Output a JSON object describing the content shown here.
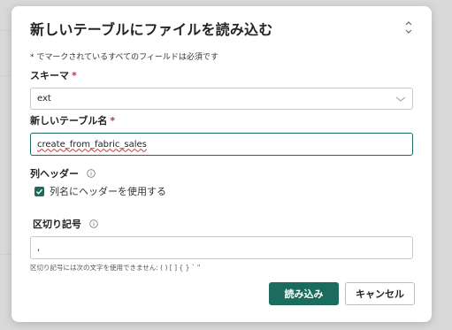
{
  "dialog": {
    "title": "新しいテーブルにファイルを読み込む",
    "required_note": "* でマークされているすべてのフィールドは必須です",
    "schema": {
      "label": "スキーマ",
      "required_mark": "*",
      "value": "ext",
      "icon": "chevron-down-icon"
    },
    "table_name": {
      "label": "新しいテーブル名",
      "required_mark": "*",
      "value": "create_from_fabric_sales"
    },
    "column_header": {
      "label": "列ヘッダー",
      "checkbox_label": "列名にヘッダーを使用する",
      "checked": true
    },
    "delimiter": {
      "label": "区切り記号",
      "value": ",",
      "helper": "区切り記号には次の文字を使用できません: ( ) [ ] { } ` \""
    },
    "buttons": {
      "load": "読み込み",
      "cancel": "キャンセル"
    }
  },
  "colors": {
    "accent": "#1b6b5e",
    "required": "#c4314b"
  }
}
